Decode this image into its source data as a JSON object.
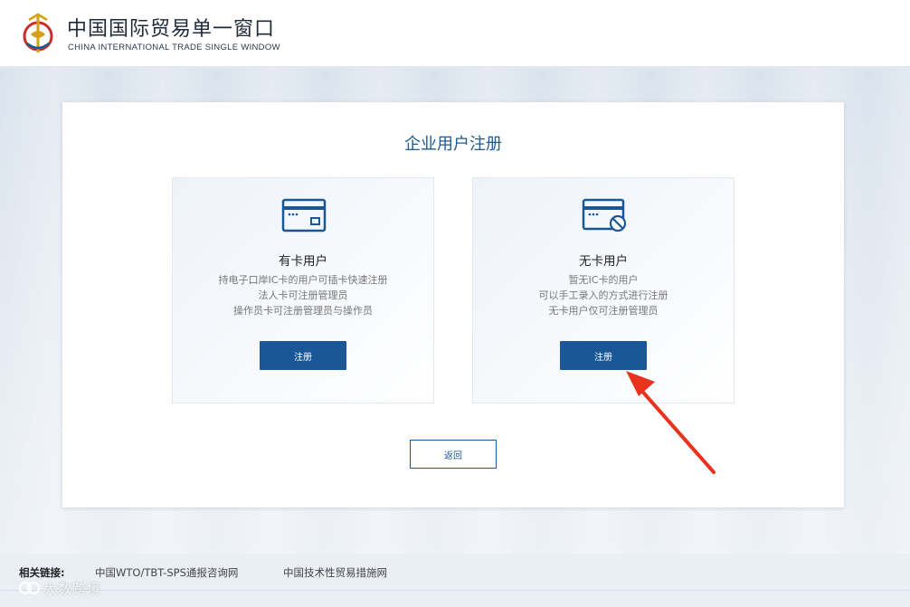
{
  "header": {
    "title_cn": "中国国际贸易单一窗口",
    "title_en": "CHINA INTERNATIONAL TRADE SINGLE WINDOW"
  },
  "panel": {
    "title": "企业用户注册",
    "cards": [
      {
        "title": "有卡用户",
        "desc": [
          "持电子口岸IC卡的用户可插卡快速注册",
          "法人卡可注册管理员",
          "操作员卡可注册管理员与操作员"
        ],
        "button": "注册",
        "icon": "ic-card-icon"
      },
      {
        "title": "无卡用户",
        "desc": [
          "暂无IC卡的用户",
          "可以手工录入的方式进行注册",
          "无卡用户仅可注册管理员"
        ],
        "button": "注册",
        "icon": "no-card-icon"
      }
    ],
    "back_button": "返回"
  },
  "footer": {
    "label": "相关链接:",
    "links": [
      "中国WTO/TBT-SPS通报咨询网",
      "中国技术性贸易措施网"
    ]
  },
  "watermark": "大数跨境",
  "colors": {
    "brand_blue": "#1a5796",
    "title_blue": "#1d5a93",
    "arrow_red": "#e8331f"
  }
}
